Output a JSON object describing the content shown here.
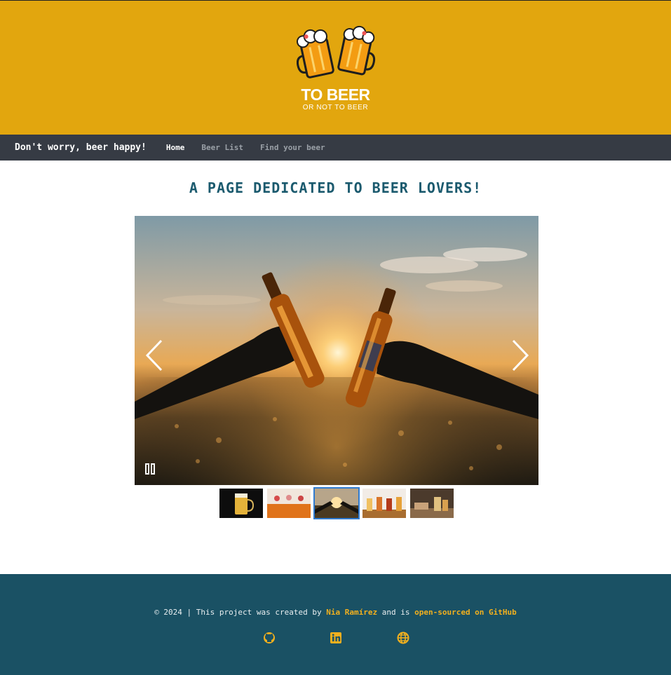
{
  "header": {
    "logo_title": "TO BEER",
    "logo_subtitle": "OR NOT TO BEER",
    "logo_icon": "beer-mugs-toast-icon"
  },
  "nav": {
    "brand": "Don't worry, beer happy!",
    "links": [
      {
        "label": "Home",
        "active": true
      },
      {
        "label": "Beer List",
        "active": false
      },
      {
        "label": "Find your beer",
        "active": false
      }
    ]
  },
  "main": {
    "headline": "A PAGE DEDICATED TO BEER LOVERS!",
    "carousel": {
      "current_slide": 3,
      "slide_count": 5,
      "icons": {
        "prev": "chevron-left-icon",
        "next": "chevron-right-icon",
        "pause": "pause-icon"
      }
    }
  },
  "footer": {
    "credit_prefix": "© 2024 | This project was created by",
    "author": "Nia Ramírez",
    "credit_middle": "and is",
    "repo_link": "open-sourced on GitHub",
    "social_icons": [
      "github-icon",
      "linkedin-icon",
      "globe-icon"
    ]
  },
  "colors": {
    "header_bg": "#e2a60e",
    "nav_bg": "#363b44",
    "headline": "#1b5a6e",
    "footer_bg": "#1a5164",
    "footer_highlight": "#f2b01e",
    "thumb_active_border": "#2f7bd1"
  }
}
